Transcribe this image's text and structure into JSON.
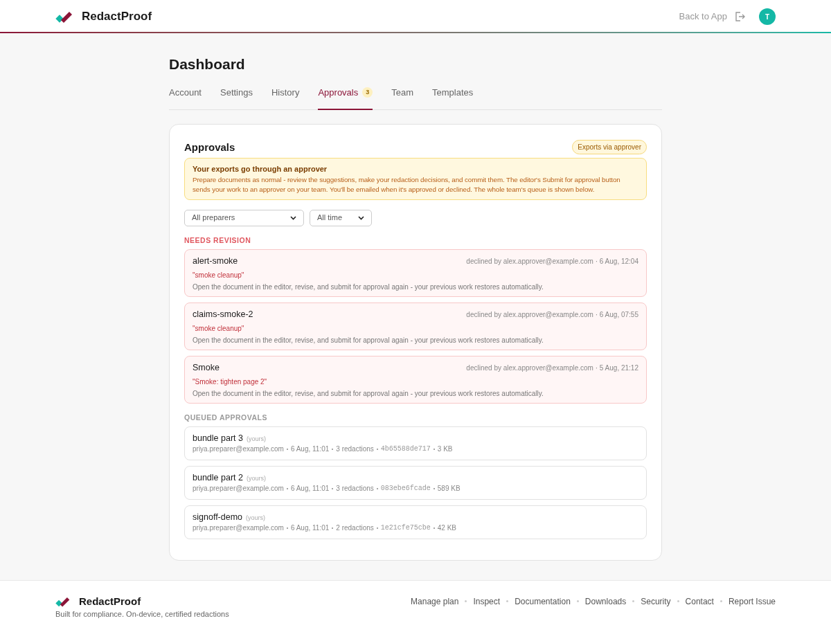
{
  "header": {
    "brand": "RedactProof",
    "back_link": "Back to App",
    "avatar": "T"
  },
  "page": {
    "title": "Dashboard"
  },
  "tabs": [
    {
      "label": "Account",
      "selected": false
    },
    {
      "label": "Settings",
      "selected": false
    },
    {
      "label": "History",
      "selected": false
    },
    {
      "label": "Approvals",
      "selected": true,
      "badge": "3"
    },
    {
      "label": "Team",
      "selected": false
    },
    {
      "label": "Templates",
      "selected": false
    }
  ],
  "panel": {
    "title": "Approvals",
    "badge": "Exports via approver",
    "notice": {
      "title": "Your exports go through an approver",
      "body": "Prepare documents as normal - review the suggestions, make your redaction decisions, and commit them. The editor's Submit for approval button sends your work to an approver on your team. You'll be emailed when it's approved or declined. The whole team's queue is shown below."
    },
    "filters": [
      {
        "value": "All preparers"
      },
      {
        "value": "All time"
      }
    ],
    "needs_revision": {
      "heading": "NEEDS REVISION",
      "items": [
        {
          "name": "alert-smoke",
          "status": "declined by alex.approver@example.com · 6 Aug, 12:04",
          "reason": "\"smoke cleanup\"",
          "hint": "Open the document in the editor, revise, and submit for approval again - your previous work restores automatically."
        },
        {
          "name": "claims-smoke-2",
          "status": "declined by alex.approver@example.com · 6 Aug, 07:55",
          "reason": "\"smoke cleanup\"",
          "hint": "Open the document in the editor, revise, and submit for approval again - your previous work restores automatically."
        },
        {
          "name": "Smoke",
          "status": "declined by alex.approver@example.com · 5 Aug, 21:12",
          "reason": "\"Smoke: tighten page 2\"",
          "hint": "Open the document in the editor, revise, and submit for approval again - your previous work restores automatically."
        }
      ]
    },
    "queued": {
      "heading": "QUEUED APPROVALS",
      "items": [
        {
          "name": "bundle part 3",
          "owner": "(yours)",
          "email": "priya.preparer@example.com",
          "time": "6 Aug, 11:01",
          "redactions": "3 redactions",
          "hash": "4b65588de717",
          "size": "3 KB"
        },
        {
          "name": "bundle part 2",
          "owner": "(yours)",
          "email": "priya.preparer@example.com",
          "time": "6 Aug, 11:01",
          "redactions": "3 redactions",
          "hash": "083ebe6fcade",
          "size": "589 KB"
        },
        {
          "name": "signoff-demo",
          "owner": "(yours)",
          "email": "priya.preparer@example.com",
          "time": "6 Aug, 11:01",
          "redactions": "2 redactions",
          "hash": "1e21cfe75cbe",
          "size": "42 KB"
        }
      ]
    }
  },
  "footer": {
    "brand": "RedactProof",
    "tagline": "Built for compliance. On-device, certified redactions",
    "links": [
      "Manage plan",
      "Inspect",
      "Documentation",
      "Downloads",
      "Security",
      "Contact",
      "Report Issue"
    ]
  }
}
